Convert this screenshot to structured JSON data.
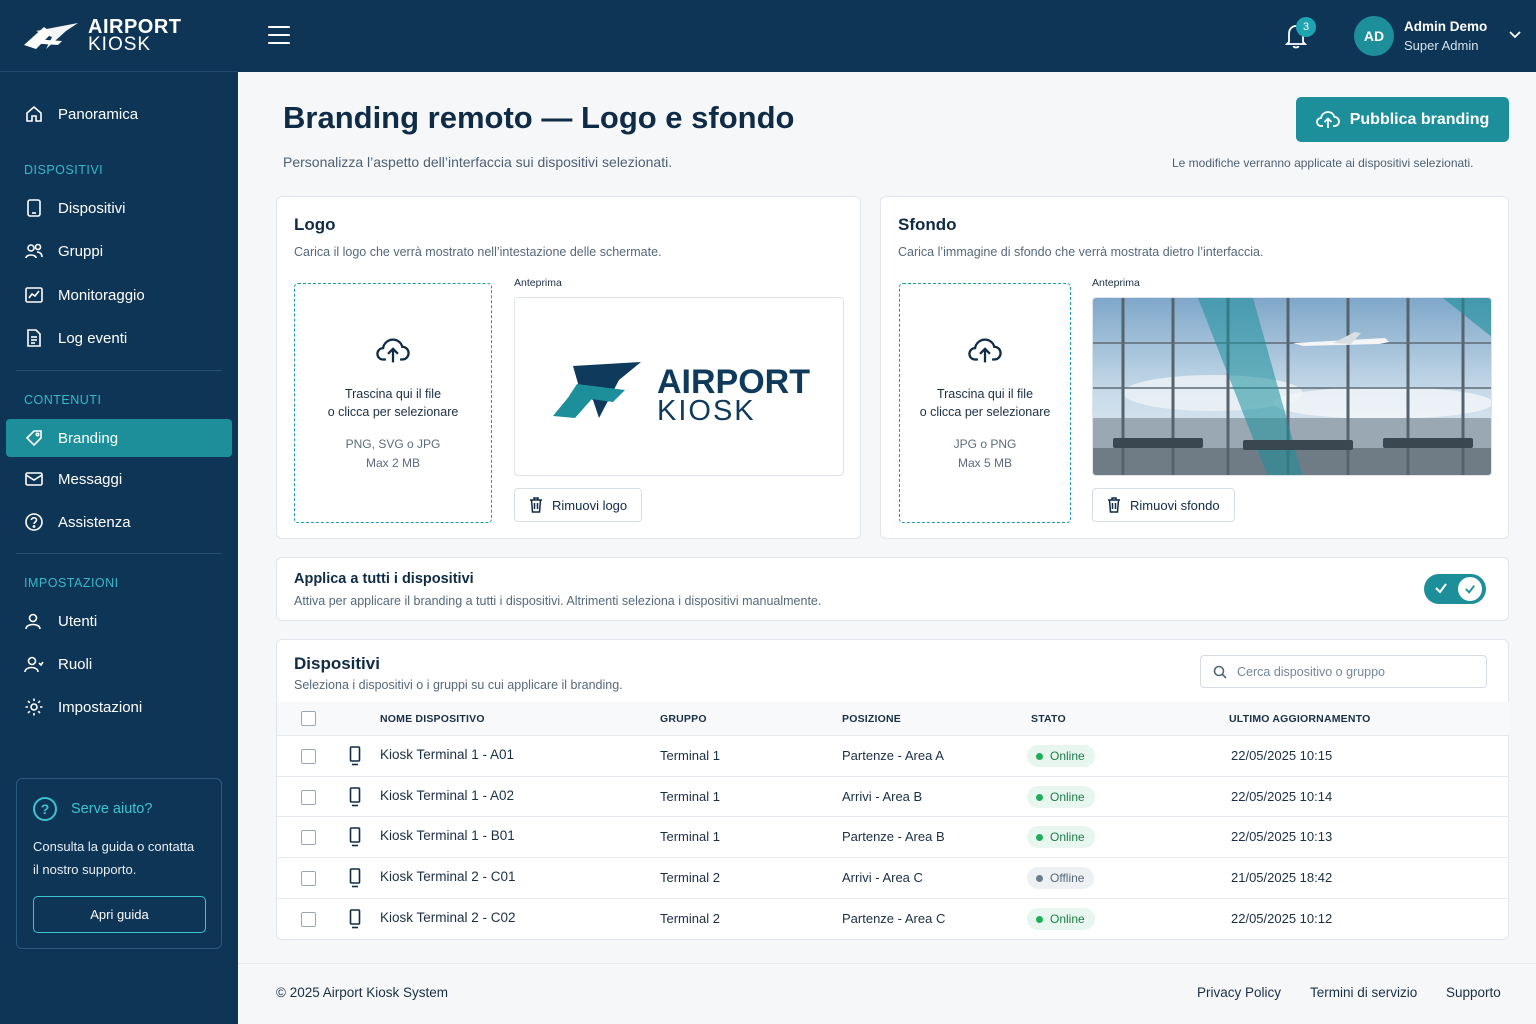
{
  "brand": {
    "line1": "AIRPORT",
    "line2": "KIOSK"
  },
  "nav": {
    "items_top": [
      {
        "label": "Panoramica",
        "icon": "home-icon"
      }
    ],
    "sections": [
      {
        "title": "DISPOSITIVI",
        "items": [
          {
            "label": "Dispositivi",
            "icon": "tablet-icon"
          },
          {
            "label": "Gruppi",
            "icon": "users-icon"
          },
          {
            "label": "Monitoraggio",
            "icon": "chart-icon"
          },
          {
            "label": "Log eventi",
            "icon": "document-icon"
          }
        ]
      },
      {
        "title": "CONTENUTI",
        "items": [
          {
            "label": "Branding",
            "icon": "tag-icon",
            "active": true
          },
          {
            "label": "Messaggi",
            "icon": "message-icon"
          },
          {
            "label": "Assistenza",
            "icon": "question-icon"
          }
        ]
      },
      {
        "title": "IMPOSTAZIONI",
        "items": [
          {
            "label": "Utenti",
            "icon": "user-icon"
          },
          {
            "label": "Ruoli",
            "icon": "roles-icon"
          },
          {
            "label": "Impostazioni",
            "icon": "gear-icon"
          }
        ]
      }
    ],
    "help": {
      "title": "Serve aiuto?",
      "desc_line1": "Consulta la guida o contatta",
      "desc_line2": "il nostro supporto.",
      "button": "Apri guida"
    }
  },
  "topbar": {
    "notifications": "3",
    "avatar_initials": "AD",
    "user_name": "Admin Demo",
    "user_role": "Super Admin"
  },
  "page": {
    "title": "Branding remoto — Logo e sfondo",
    "subtitle": "Personalizza l’aspetto dell’interfaccia sui dispositivi selezionati.",
    "publish_label": "Pubblica branding",
    "publish_note": "Le modifiche verranno applicate ai dispositivi selezionati."
  },
  "logo_card": {
    "title": "Logo",
    "subtitle": "Carica il logo che verrà mostrato nell’intestazione delle schermate.",
    "drop_line1": "Trascina qui il file",
    "drop_line2": "o clicca per selezionare",
    "formats": "PNG, SVG o JPG",
    "max": "Max 2 MB",
    "preview_label": "Anteprima",
    "preview_logo_line1": "AIRPORT",
    "preview_logo_line2": "KIOSK",
    "remove_label": "Rimuovi logo"
  },
  "bg_card": {
    "title": "Sfondo",
    "subtitle": "Carica l’immagine di sfondo che verrà mostrata dietro l’interfaccia.",
    "drop_line1": "Trascina qui il file",
    "drop_line2": "o clicca per selezionare",
    "formats": "JPG o PNG",
    "max": "Max 5 MB",
    "preview_label": "Anteprima",
    "remove_label": "Rimuovi sfondo"
  },
  "apply_all": {
    "title": "Applica a tutti i dispositivi",
    "subtitle": "Attiva per applicare il branding a tutti i dispositivi. Altrimenti seleziona i dispositivi manualmente.",
    "enabled": true
  },
  "devices": {
    "title": "Dispositivi",
    "subtitle": "Seleziona i dispositivi o i gruppi su cui applicare il branding.",
    "search_placeholder": "Cerca dispositivo o gruppo",
    "columns": [
      "NOME DISPOSITIVO",
      "GRUPPO",
      "POSIZIONE",
      "STATO",
      "ULTIMO AGGIORNAMENTO"
    ],
    "rows": [
      {
        "name": "Kiosk Terminal 1 - A01",
        "group": "Terminal 1",
        "position": "Partenze - Area A",
        "status": "Online",
        "updated": "22/05/2025 10:15"
      },
      {
        "name": "Kiosk Terminal 1 - A02",
        "group": "Terminal 1",
        "position": "Arrivi - Area B",
        "status": "Online",
        "updated": "22/05/2025 10:14"
      },
      {
        "name": "Kiosk Terminal 1 - B01",
        "group": "Terminal 1",
        "position": "Partenze - Area B",
        "status": "Online",
        "updated": "22/05/2025 10:13"
      },
      {
        "name": "Kiosk Terminal 2 - C01",
        "group": "Terminal 2",
        "position": "Arrivi - Area C",
        "status": "Offline",
        "updated": "21/05/2025 18:42"
      },
      {
        "name": "Kiosk Terminal 2 - C02",
        "group": "Terminal 2",
        "position": "Partenze - Area C",
        "status": "Online",
        "updated": "22/05/2025 10:12"
      }
    ]
  },
  "footer": {
    "copyright": "© 2025 Airport Kiosk System",
    "links": [
      "Privacy Policy",
      "Termini di servizio",
      "Supporto"
    ]
  },
  "colors": {
    "sidebar": "#0e3556",
    "accent": "#1c8f9a",
    "online": "#1fad5b",
    "offline": "#6d7b8c"
  }
}
